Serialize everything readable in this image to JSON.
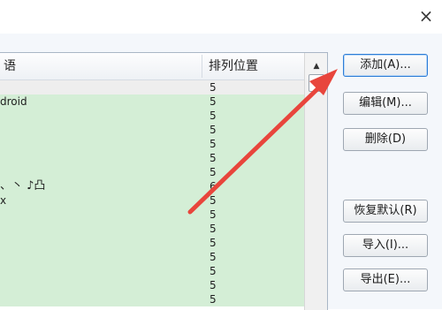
{
  "window": {
    "close_glyph": "×"
  },
  "list": {
    "columns": [
      "语",
      "排列位置"
    ],
    "scroll_up_glyph": "▲",
    "rows": [
      {
        "name": "",
        "pos": "5"
      },
      {
        "name": "droid",
        "pos": "5"
      },
      {
        "name": "",
        "pos": "5"
      },
      {
        "name": "",
        "pos": "5"
      },
      {
        "name": "",
        "pos": "5"
      },
      {
        "name": "",
        "pos": "5"
      },
      {
        "name": "",
        "pos": "5"
      },
      {
        "name": "、丶 ♪凸",
        "pos": "6"
      },
      {
        "name": "x",
        "pos": "5"
      },
      {
        "name": "",
        "pos": "5"
      },
      {
        "name": "",
        "pos": "5"
      },
      {
        "name": "",
        "pos": "5"
      },
      {
        "name": "",
        "pos": "5"
      },
      {
        "name": "",
        "pos": "5"
      },
      {
        "name": "",
        "pos": "5"
      },
      {
        "name": "",
        "pos": "5"
      }
    ]
  },
  "buttons": {
    "add": "添加(A)...",
    "edit": "编辑(M)...",
    "delete": "删除(D)",
    "restore": "恢复默认(R)",
    "import": "导入(I)...",
    "export": "导出(E)..."
  },
  "colors": {
    "arrow": "#e8453c",
    "row_highlight": "#d4eed6",
    "focus_border": "#2e7dd6"
  }
}
